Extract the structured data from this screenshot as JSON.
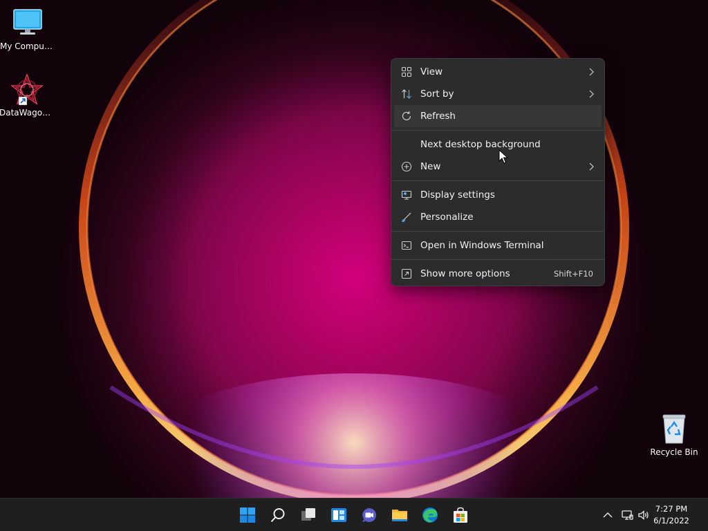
{
  "desktop": {
    "icons": [
      {
        "label": "My Computer",
        "icon": "monitor-icon"
      },
      {
        "label": "DataWagon...",
        "icon": "app-shortcut-icon"
      },
      {
        "label": "Recycle Bin",
        "icon": "recycle-bin-icon"
      }
    ]
  },
  "context_menu": {
    "items": [
      {
        "label": "View",
        "icon": "grid-icon",
        "submenu": true
      },
      {
        "label": "Sort by",
        "icon": "sort-icon",
        "submenu": true
      },
      {
        "label": "Refresh",
        "icon": "refresh-icon"
      },
      {
        "label": "Next desktop background"
      },
      {
        "label": "New",
        "icon": "plus-circle-icon",
        "submenu": true
      },
      {
        "label": "Display settings",
        "icon": "display-icon"
      },
      {
        "label": "Personalize",
        "icon": "brush-icon"
      },
      {
        "label": "Open in Windows Terminal",
        "icon": "terminal-icon"
      },
      {
        "label": "Show more options",
        "icon": "share-icon",
        "accelerator": "Shift+F10"
      }
    ]
  },
  "taskbar": {
    "apps": [
      "start-icon",
      "search-icon",
      "task-view-icon",
      "widgets-icon",
      "chat-icon",
      "file-explorer-icon",
      "edge-icon",
      "store-icon"
    ],
    "tray": [
      "chevron-up-icon",
      "network-icon",
      "volume-icon"
    ],
    "clock": {
      "time": "7:27 PM",
      "date": "6/1/2022"
    }
  },
  "colors": {
    "accent": "#0078d4",
    "menu_bg": "#2c2c2c",
    "taskbar_bg": "#1f1f1f"
  }
}
